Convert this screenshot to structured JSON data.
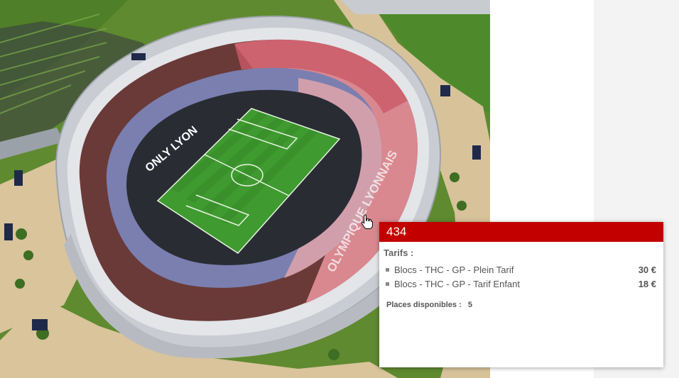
{
  "tooltip": {
    "block_number": "434",
    "tarifs_title": "Tarifs :",
    "tarifs": [
      {
        "label": "Blocs - THC - GP - Plein Tarif",
        "price": "30 €"
      },
      {
        "label": "Blocs - THC - GP - Tarif Enfant",
        "price": "18 €"
      }
    ],
    "places_label": "Places disponibles :",
    "places_value": "5"
  },
  "stadium": {
    "stand_text_left": "ONLY LYON",
    "stand_text_right": "OLYMPIQUE LYONNAIS"
  },
  "colors": {
    "tooltip_header": "#c20000",
    "selected_stand": "#e28a92",
    "lower_stand": "#7a7fb0",
    "upper_stand": "#6a3a38",
    "pitch": "#3f9a30"
  },
  "icons": {
    "cursor": "hand-pointer-icon"
  }
}
